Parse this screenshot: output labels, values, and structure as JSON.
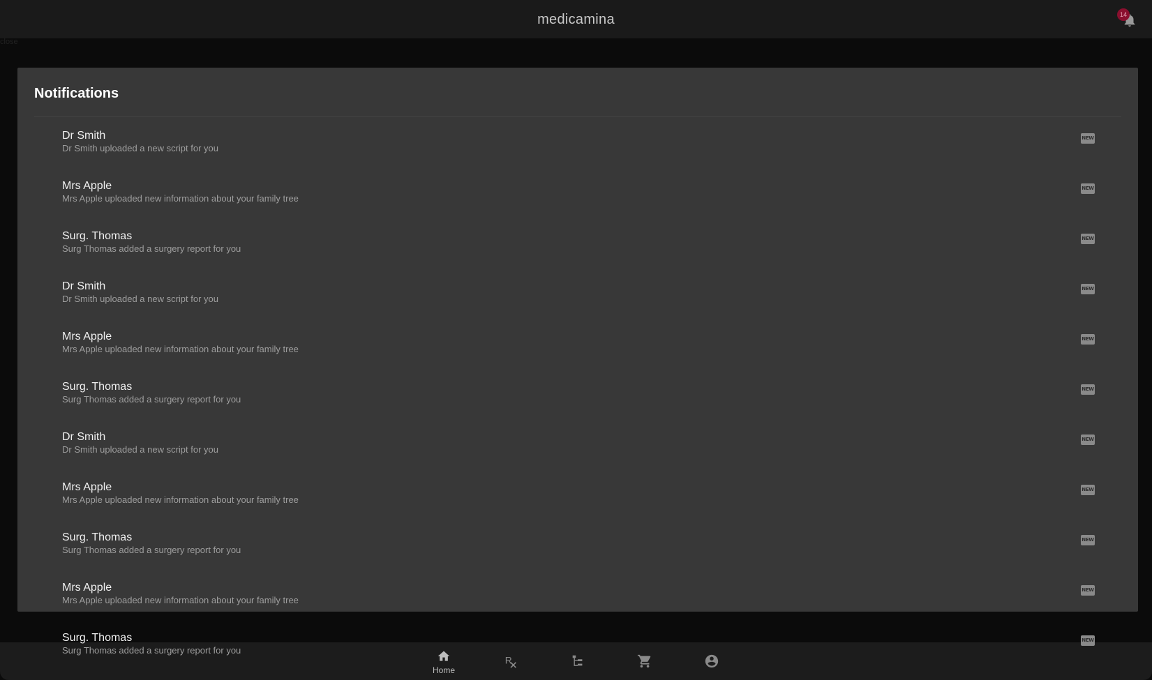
{
  "app": {
    "title": "medicamina",
    "notification_count": "14",
    "stray_text": "close"
  },
  "panel": {
    "title": "Notifications"
  },
  "notifications": [
    {
      "title": "Dr Smith",
      "subtitle": "Dr Smith uploaded a new script for you",
      "badge": "NEW"
    },
    {
      "title": "Mrs Apple",
      "subtitle": "Mrs Apple uploaded new information about your family tree",
      "badge": "NEW"
    },
    {
      "title": "Surg. Thomas",
      "subtitle": "Surg Thomas added a surgery report for you",
      "badge": "NEW"
    },
    {
      "title": "Dr Smith",
      "subtitle": "Dr Smith uploaded a new script for you",
      "badge": "NEW"
    },
    {
      "title": "Mrs Apple",
      "subtitle": "Mrs Apple uploaded new information about your family tree",
      "badge": "NEW"
    },
    {
      "title": "Surg. Thomas",
      "subtitle": "Surg Thomas added a surgery report for you",
      "badge": "NEW"
    },
    {
      "title": "Dr Smith",
      "subtitle": "Dr Smith uploaded a new script for you",
      "badge": "NEW"
    },
    {
      "title": "Mrs Apple",
      "subtitle": "Mrs Apple uploaded new information about your family tree",
      "badge": "NEW"
    },
    {
      "title": "Surg. Thomas",
      "subtitle": "Surg Thomas added a surgery report for you",
      "badge": "NEW"
    },
    {
      "title": "Mrs Apple",
      "subtitle": "Mrs Apple uploaded new information about your family tree",
      "badge": "NEW"
    },
    {
      "title": "Surg. Thomas",
      "subtitle": "Surg Thomas added a surgery report for you",
      "badge": "NEW"
    }
  ],
  "bottom_nav": {
    "items": [
      {
        "icon": "home-icon",
        "label": "Home"
      },
      {
        "icon": "prescription-icon",
        "label": ""
      },
      {
        "icon": "family-tree-icon",
        "label": ""
      },
      {
        "icon": "cart-icon",
        "label": ""
      },
      {
        "icon": "account-icon",
        "label": ""
      }
    ]
  }
}
